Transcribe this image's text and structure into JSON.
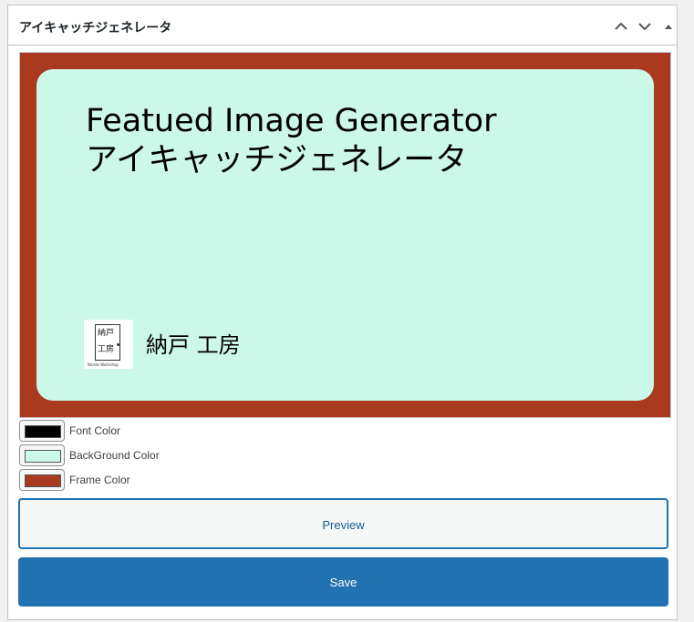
{
  "panel": {
    "title": "アイキャッチジェネレータ",
    "icons": [
      "chevron-up-icon",
      "chevron-down-icon",
      "toggle-triangle-icon"
    ]
  },
  "preview_image": {
    "title_line1": "Featued Image Generator",
    "title_line2": "アイキャッチジェネレータ",
    "logo_line1": "納戸",
    "logo_line2": "工房",
    "logo_subtext": "Nando Workshop",
    "brand_name": "納戸 工房",
    "font_color": "#000000",
    "background_color": "#ccf8e9",
    "frame_color": "#a9391f"
  },
  "colors": [
    {
      "label": "Font Color",
      "value": "#000000"
    },
    {
      "label": "BackGround Color",
      "value": "#ccf8e9"
    },
    {
      "label": "Frame Color",
      "value": "#a9391f"
    }
  ],
  "buttons": {
    "preview": "Preview",
    "save": "Save"
  }
}
